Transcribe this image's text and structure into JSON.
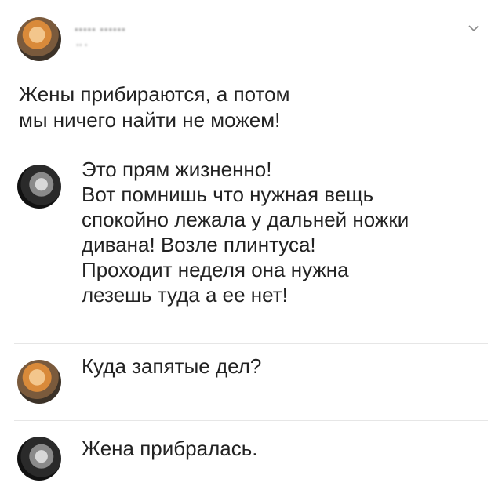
{
  "post": {
    "author_name": "••••• ••••••",
    "author_meta": "•• •",
    "menu_icon": "chevron-down-icon",
    "text": "Жены прибираются, а потом\nмы ничего найти не можем!"
  },
  "replies": [
    {
      "avatar": "avatar-dark",
      "text": "Это прям жизненно!\nВот помнишь что нужная вещь\nспокойно лежала у дальней ножки\nдивана! Возле плинтуса!\nПроходит неделя она нужна\nлезешь туда а ее нет!"
    },
    {
      "avatar": "avatar-orange",
      "text": "Куда запятые дел?"
    },
    {
      "avatar": "avatar-dark",
      "text": "Жена прибралась."
    }
  ],
  "colors": {
    "background": "#ffffff",
    "text": "#222222",
    "divider": "#e6e6e6"
  }
}
